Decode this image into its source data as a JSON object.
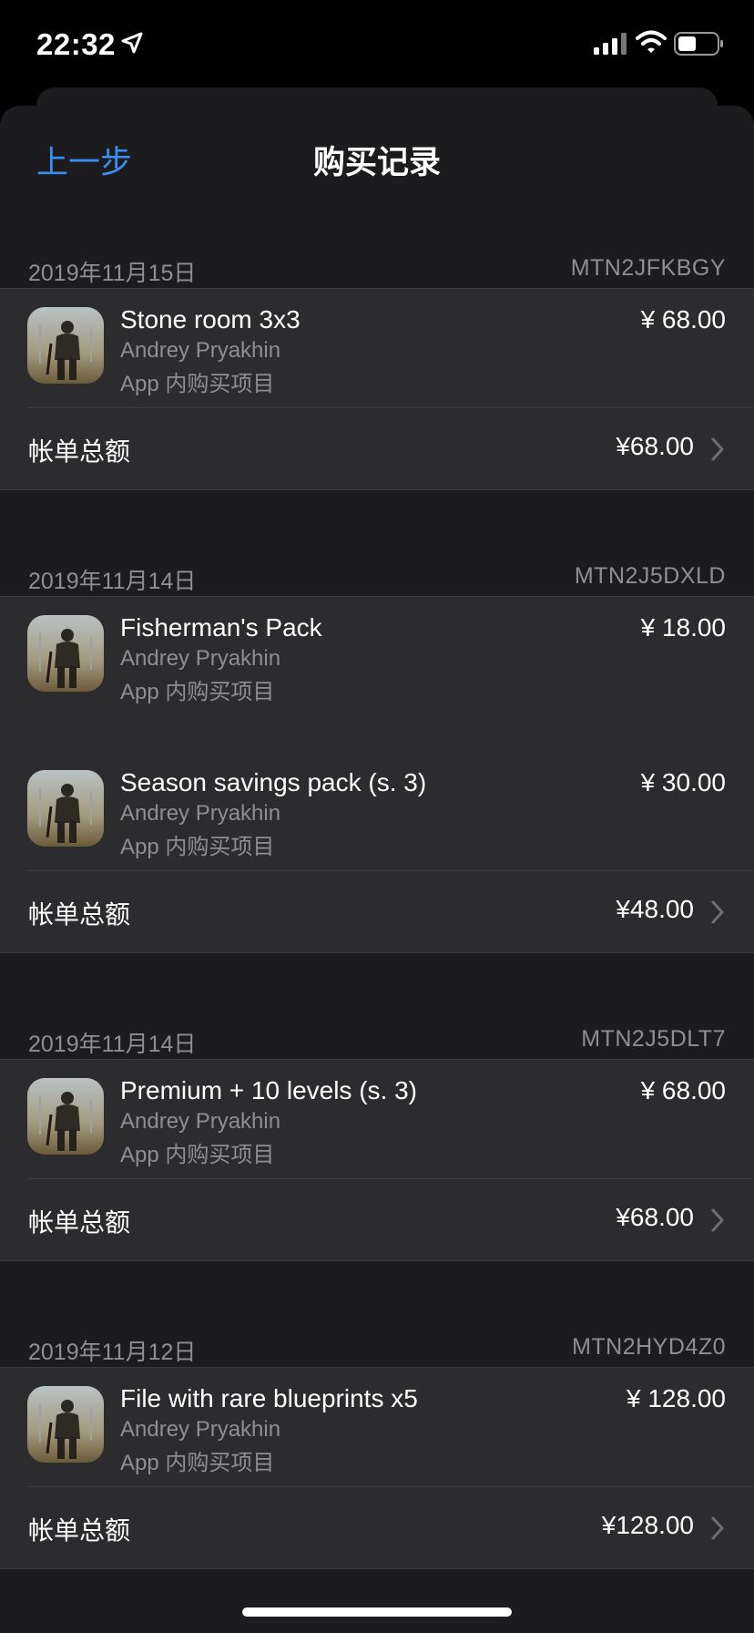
{
  "status_bar": {
    "time": "22:32"
  },
  "nav": {
    "back_label": "上一步",
    "title": "购买记录"
  },
  "groups": [
    {
      "date": "2019年11月15日",
      "order_id": "MTN2JFKBGY",
      "items": [
        {
          "name": "Stone room 3x3",
          "developer": "Andrey Pryakhin",
          "type": "App 内购买项目",
          "price": "¥ 68.00"
        }
      ],
      "total_label": "帐单总额",
      "total": "¥68.00"
    },
    {
      "date": "2019年11月14日",
      "order_id": "MTN2J5DXLD",
      "items": [
        {
          "name": "Fisherman's Pack",
          "developer": "Andrey Pryakhin",
          "type": "App 内购买项目",
          "price": "¥ 18.00"
        },
        {
          "name": "Season savings pack (s. 3)",
          "developer": "Andrey Pryakhin",
          "type": "App 内购买项目",
          "price": "¥ 30.00"
        }
      ],
      "total_label": "帐单总额",
      "total": "¥48.00"
    },
    {
      "date": "2019年11月14日",
      "order_id": "MTN2J5DLT7",
      "items": [
        {
          "name": "Premium + 10 levels (s. 3)",
          "developer": "Andrey Pryakhin",
          "type": "App 内购买项目",
          "price": "¥ 68.00"
        }
      ],
      "total_label": "帐单总额",
      "total": "¥68.00"
    },
    {
      "date": "2019年11月12日",
      "order_id": "MTN2HYD4Z0",
      "items": [
        {
          "name": "File with rare blueprints x5",
          "developer": "Andrey Pryakhin",
          "type": "App 内购买项目",
          "price": "¥ 128.00"
        }
      ],
      "total_label": "帐单总额",
      "total": "¥128.00"
    }
  ]
}
